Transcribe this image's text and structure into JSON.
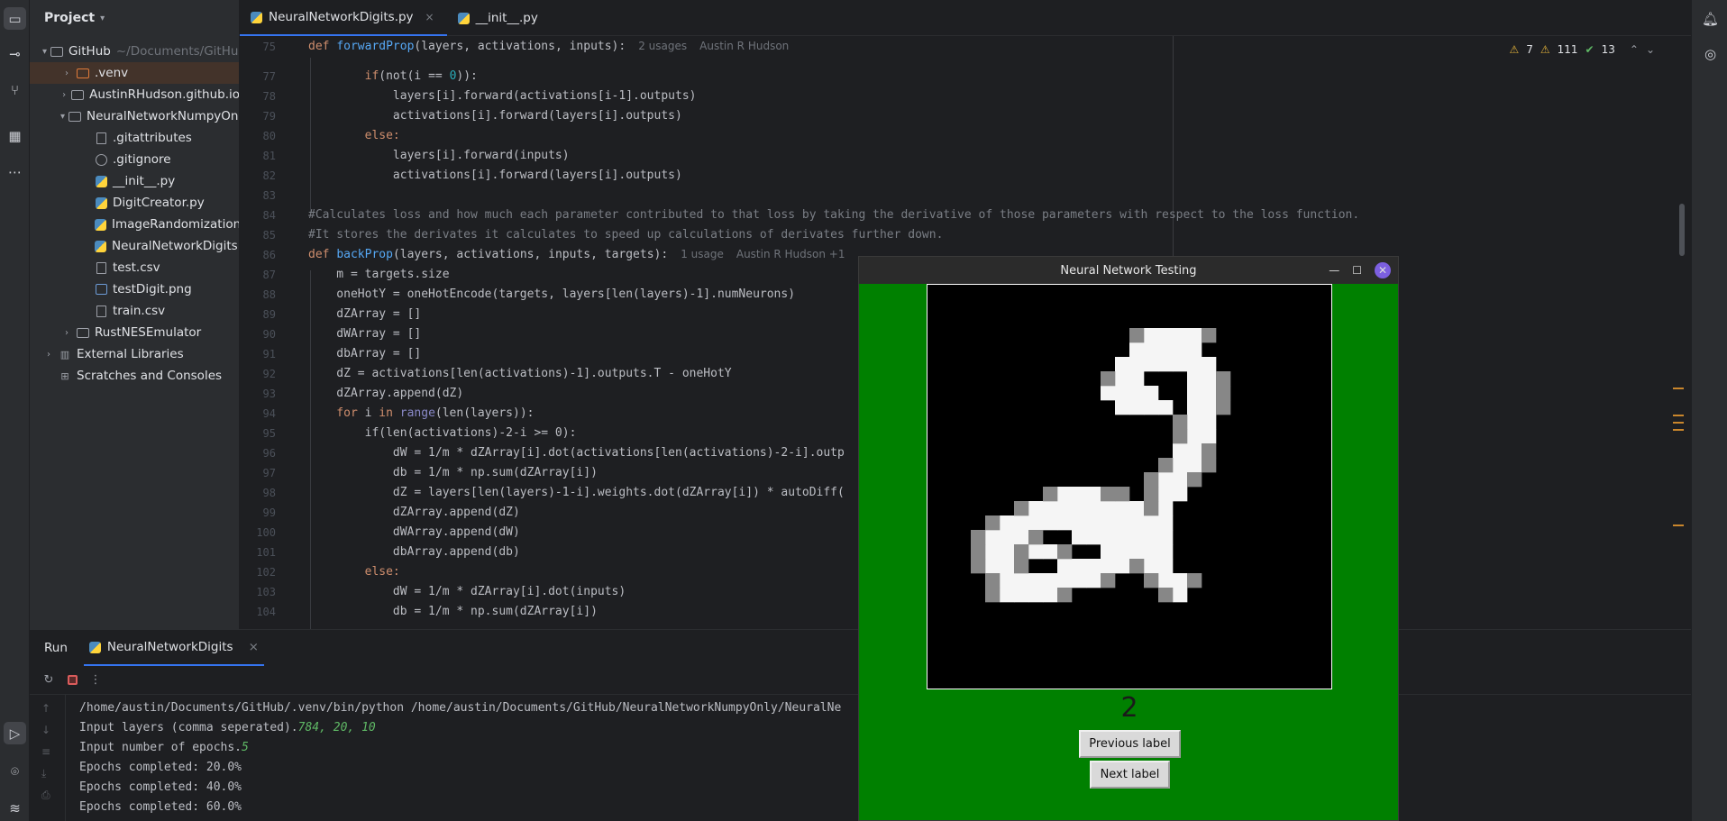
{
  "project": {
    "title": "Project",
    "items": [
      {
        "label": "GitHub",
        "extra": "~/Documents/GitHub",
        "icon": "folder-icon"
      },
      {
        "label": ".venv",
        "extra": "",
        "icon": "folder-icon"
      },
      {
        "label": "AustinRHudson.github.io",
        "extra": "",
        "icon": "folder-icon"
      },
      {
        "label": "NeuralNetworkNumpyOnly",
        "extra": "",
        "icon": "folder-icon"
      },
      {
        "label": ".gitattributes",
        "extra": "",
        "icon": "text-file-icon"
      },
      {
        "label": ".gitignore",
        "extra": "",
        "icon": "ignore-file-icon"
      },
      {
        "label": "__init__.py",
        "extra": "",
        "icon": "python-file-icon"
      },
      {
        "label": "DigitCreator.py",
        "extra": "",
        "icon": "python-file-icon"
      },
      {
        "label": "ImageRandomization.py",
        "extra": "",
        "icon": "python-file-icon"
      },
      {
        "label": "NeuralNetworkDigits.py",
        "extra": "",
        "icon": "python-file-icon"
      },
      {
        "label": "test.csv",
        "extra": "",
        "icon": "csv-file-icon"
      },
      {
        "label": "testDigit.png",
        "extra": "",
        "icon": "image-file-icon"
      },
      {
        "label": "train.csv",
        "extra": "",
        "icon": "csv-file-icon"
      },
      {
        "label": "RustNESEmulator",
        "extra": "",
        "icon": "folder-icon"
      },
      {
        "label": "External Libraries",
        "extra": "",
        "icon": "library-icon"
      },
      {
        "label": "Scratches and Consoles",
        "extra": "",
        "icon": "scratches-icon"
      }
    ]
  },
  "tabs": [
    {
      "label": "NeuralNetworkDigits.py",
      "close": "×"
    },
    {
      "label": "__init__.py",
      "close": ""
    }
  ],
  "inspections": {
    "warnings": "7",
    "weak_warnings": "111",
    "typos": "13"
  },
  "editor": {
    "line_numbers": [
      "75",
      "77",
      "78",
      "79",
      "80",
      "81",
      "82",
      "83",
      "84",
      "85",
      "86",
      "87",
      "88",
      "89",
      "90",
      "91",
      "92",
      "93",
      "94",
      "95",
      "96",
      "97",
      "98",
      "99",
      "100",
      "101",
      "102",
      "103",
      "104"
    ],
    "lines": {
      "l75a": "def ",
      "l75b": "forwardProp",
      "l75c": "(layers, activations, inputs):",
      "l75hint": "2 usages",
      "l75author": "Austin R Hudson",
      "l77a": "        if",
      "l77b": "(not(i == ",
      "l77c": "0",
      "l77d": ")):",
      "l78": "            layers[i].forward(activations[i-1].outputs)",
      "l79": "            activations[i].forward(layers[i].outputs)",
      "l80": "        else:",
      "l81": "            layers[i].forward(inputs)",
      "l82": "            activations[i].forward(layers[i].outputs)",
      "l84": "#Calculates loss and how much each parameter contributed to that loss by taking the derivative of those parameters with respect to the loss function.",
      "l85": "#It stores the derivates it calculates to speed up calculations of derivates further down.",
      "l86a": "def ",
      "l86b": "backProp",
      "l86c": "(layers, activations, inputs, targets):",
      "l86hint": "1 usage",
      "l86author": "Austin R Hudson +1",
      "l87": "    m = targets.size",
      "l88": "    oneHotY = oneHotEncode(targets, layers[len(layers)-1].numNeurons)",
      "l89": "    dZArray = []",
      "l90": "    dWArray = []",
      "l91": "    dbArray = []",
      "l92": "    dZ = activations[len(activations)-1].outputs.T - oneHotY",
      "l93": "    dZArray.append(dZ)",
      "l94a": "    for ",
      "l94b": "i",
      "l94c": " in ",
      "l94d": "range",
      "l94e": "(len(layers)):",
      "l95": "        if(len(activations)-2-i >= 0):",
      "l96": "            dW = 1/m * dZArray[i].dot(activations[len(activations)-2-i].outp",
      "l97": "            db = 1/m * np.sum(dZArray[i])",
      "l98": "            dZ = layers[len(layers)-1-i].weights.dot(dZArray[i]) * autoDiff(",
      "l99": "            dZArray.append(dZ)",
      "l100": "            dWArray.append(dW)",
      "l101": "            dbArray.append(db)",
      "l102": "        else:",
      "l103": "            dW = 1/m * dZArray[i].dot(inputs)",
      "l104": "            db = 1/m * np.sum(dZArray[i])"
    }
  },
  "run": {
    "tab_run": "Run",
    "tab_config": "NeuralNetworkDigits",
    "close": "×",
    "console": {
      "cmd": "/home/austin/Documents/GitHub/.venv/bin/python /home/austin/Documents/GitHub/NeuralNetworkNumpyOnly/NeuralNe",
      "prompt1": "Input layers (comma seperated).",
      "input1": "784, 20, 10",
      "prompt2": "Input number of epochs.",
      "input2": "5",
      "epoch1": "Epochs completed: 20.0%",
      "epoch2": "Epochs completed: 40.0%",
      "epoch3": "Epochs completed: 60.0%"
    }
  },
  "tk_window": {
    "title": "Neural Network Testing",
    "predicted_label": "2",
    "prev_button": "Previous label",
    "next_button": "Next label",
    "bg_color": "#008000"
  }
}
